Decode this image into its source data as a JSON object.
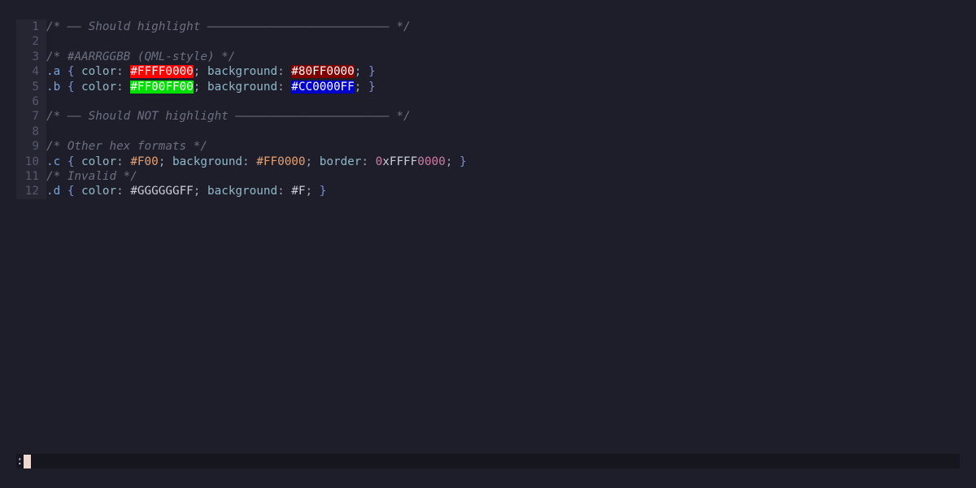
{
  "editor": {
    "lines": [
      {
        "n": "1",
        "tokens": [
          {
            "t": "/* —— Should highlight —————————————————————————— */",
            "c": "comment"
          }
        ]
      },
      {
        "n": "2",
        "tokens": []
      },
      {
        "n": "3",
        "tokens": [
          {
            "t": "/* #AARRGGBB (QML-style) */",
            "c": "comment"
          }
        ]
      },
      {
        "n": "4",
        "tokens": [
          {
            "t": ".a",
            "c": "sel"
          },
          {
            "t": " ",
            "c": "plain"
          },
          {
            "t": "{",
            "c": "brace"
          },
          {
            "t": " color",
            "c": "prop"
          },
          {
            "t": ": ",
            "c": "punct"
          },
          {
            "t": "#FFFF0000",
            "c": "hl",
            "bg": "#ff0000"
          },
          {
            "t": "; ",
            "c": "punct"
          },
          {
            "t": "background",
            "c": "prop"
          },
          {
            "t": ": ",
            "c": "punct"
          },
          {
            "t": "#80FF0000",
            "c": "hl",
            "bg": "#800000"
          },
          {
            "t": "; ",
            "c": "punct"
          },
          {
            "t": "}",
            "c": "brace"
          }
        ]
      },
      {
        "n": "5",
        "tokens": [
          {
            "t": ".b",
            "c": "sel"
          },
          {
            "t": " ",
            "c": "plain"
          },
          {
            "t": "{",
            "c": "brace"
          },
          {
            "t": " color",
            "c": "prop"
          },
          {
            "t": ": ",
            "c": "punct"
          },
          {
            "t": "#FF00FF00",
            "c": "hl",
            "bg": "#00e000"
          },
          {
            "t": "; ",
            "c": "punct"
          },
          {
            "t": "background",
            "c": "prop"
          },
          {
            "t": ": ",
            "c": "punct"
          },
          {
            "t": "#CC0000FF",
            "c": "hl",
            "bg": "#0000cc"
          },
          {
            "t": "; ",
            "c": "punct"
          },
          {
            "t": "}",
            "c": "brace"
          }
        ]
      },
      {
        "n": "6",
        "tokens": []
      },
      {
        "n": "7",
        "tokens": [
          {
            "t": "/* —— Should NOT highlight —————————————————————— */",
            "c": "comment"
          }
        ]
      },
      {
        "n": "8",
        "tokens": []
      },
      {
        "n": "9",
        "tokens": [
          {
            "t": "/* Other hex formats */",
            "c": "comment"
          }
        ]
      },
      {
        "n": "10",
        "tokens": [
          {
            "t": ".c",
            "c": "sel"
          },
          {
            "t": " ",
            "c": "plain"
          },
          {
            "t": "{",
            "c": "brace"
          },
          {
            "t": " color",
            "c": "prop"
          },
          {
            "t": ": ",
            "c": "punct"
          },
          {
            "t": "#F00",
            "c": "num"
          },
          {
            "t": "; ",
            "c": "punct"
          },
          {
            "t": "background",
            "c": "prop"
          },
          {
            "t": ": ",
            "c": "punct"
          },
          {
            "t": "#FF0000",
            "c": "num"
          },
          {
            "t": "; ",
            "c": "punct"
          },
          {
            "t": "border",
            "c": "prop"
          },
          {
            "t": ": ",
            "c": "punct"
          },
          {
            "t": "0",
            "c": "pink"
          },
          {
            "t": "xFFFF",
            "c": "plain"
          },
          {
            "t": "0000",
            "c": "pink"
          },
          {
            "t": "; ",
            "c": "punct"
          },
          {
            "t": "}",
            "c": "brace"
          }
        ]
      },
      {
        "n": "11",
        "tokens": [
          {
            "t": "/* Invalid */",
            "c": "comment"
          }
        ]
      },
      {
        "n": "12",
        "tokens": [
          {
            "t": ".d",
            "c": "sel"
          },
          {
            "t": " ",
            "c": "plain"
          },
          {
            "t": "{",
            "c": "brace"
          },
          {
            "t": " color",
            "c": "prop"
          },
          {
            "t": ": ",
            "c": "punct"
          },
          {
            "t": "#GGGGGGFF",
            "c": "plain"
          },
          {
            "t": "; ",
            "c": "punct"
          },
          {
            "t": "background",
            "c": "prop"
          },
          {
            "t": ": ",
            "c": "punct"
          },
          {
            "t": "#F",
            "c": "plain"
          },
          {
            "t": "; ",
            "c": "punct"
          },
          {
            "t": "}",
            "c": "brace"
          }
        ]
      }
    ]
  },
  "cmdline": {
    "prompt": ":"
  },
  "colors": {
    "background": "#1e1e2a",
    "gutter": "#262633",
    "cmdline_bg": "#16161e",
    "cursor": "#f0d8d0"
  }
}
